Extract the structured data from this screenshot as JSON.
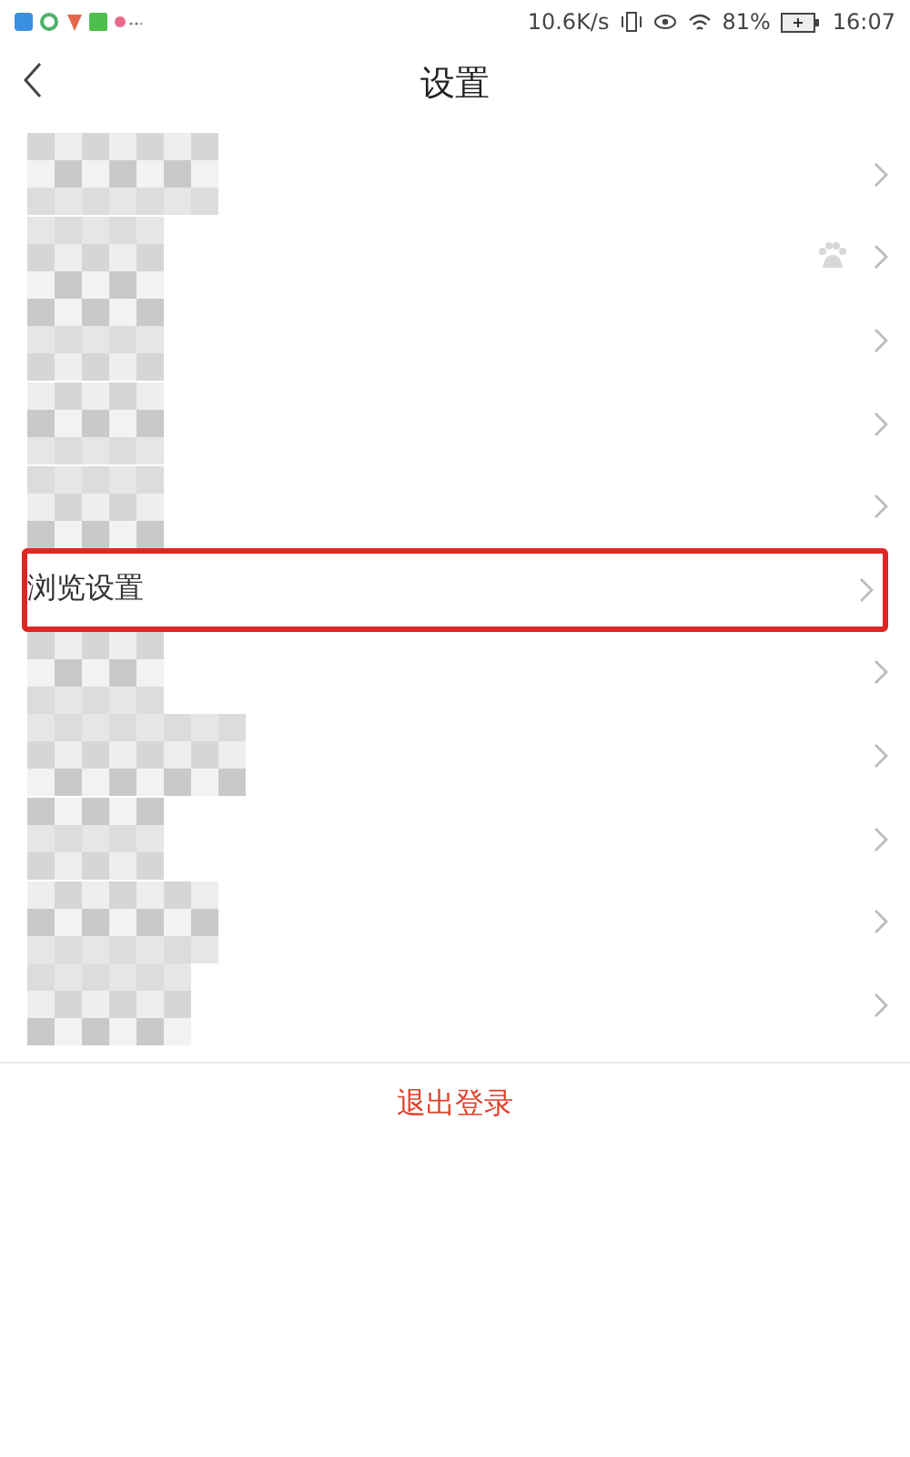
{
  "status_bar": {
    "speed": "10.6K/s",
    "battery": "81%",
    "time": "16:07"
  },
  "header": {
    "title": "设置"
  },
  "items": [
    {
      "kind": "blurred",
      "highlighted": false
    },
    {
      "kind": "blurred_with_icon",
      "highlighted": false
    },
    {
      "kind": "blurred",
      "highlighted": false
    },
    {
      "kind": "blurred",
      "highlighted": false
    },
    {
      "kind": "blurred",
      "highlighted": false
    },
    {
      "kind": "text",
      "label": "浏览设置",
      "highlighted": true
    },
    {
      "kind": "blurred",
      "highlighted": false
    },
    {
      "kind": "blurred",
      "highlighted": false
    },
    {
      "kind": "blurred",
      "highlighted": false
    },
    {
      "kind": "blurred",
      "highlighted": false
    },
    {
      "kind": "blurred",
      "highlighted": false
    }
  ],
  "logout": {
    "label": "退出登录"
  }
}
